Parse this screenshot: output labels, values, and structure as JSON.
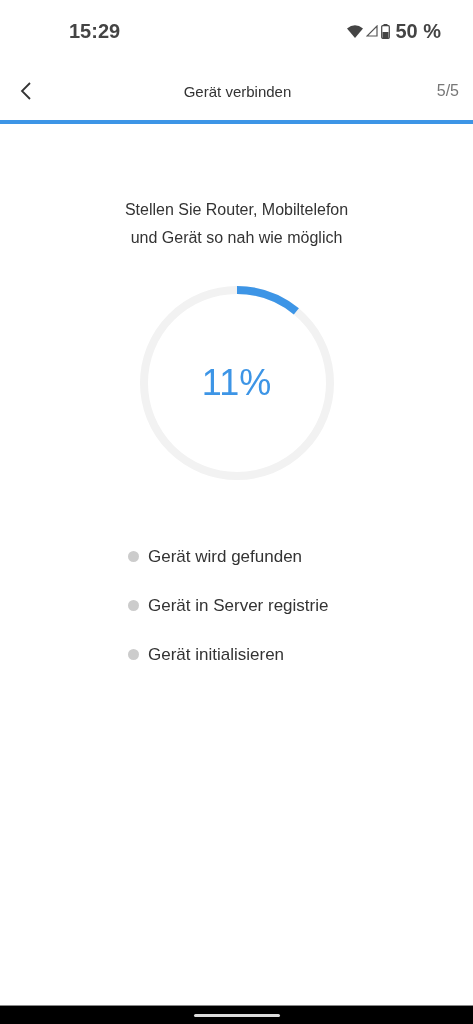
{
  "status_bar": {
    "time": "15:29",
    "battery": "50 %"
  },
  "header": {
    "title": "Gerät verbinden",
    "step": "5/5"
  },
  "instruction": "Stellen Sie Router, Mobiltelefon und Gerät so nah wie möglich",
  "progress": {
    "level": 0.11,
    "reading": "11%"
  },
  "steps": [
    {
      "label": "Gerät wird gefunden"
    },
    {
      "label": "Gerät in Server registrie"
    },
    {
      "label": "Gerät initialisieren"
    }
  ]
}
